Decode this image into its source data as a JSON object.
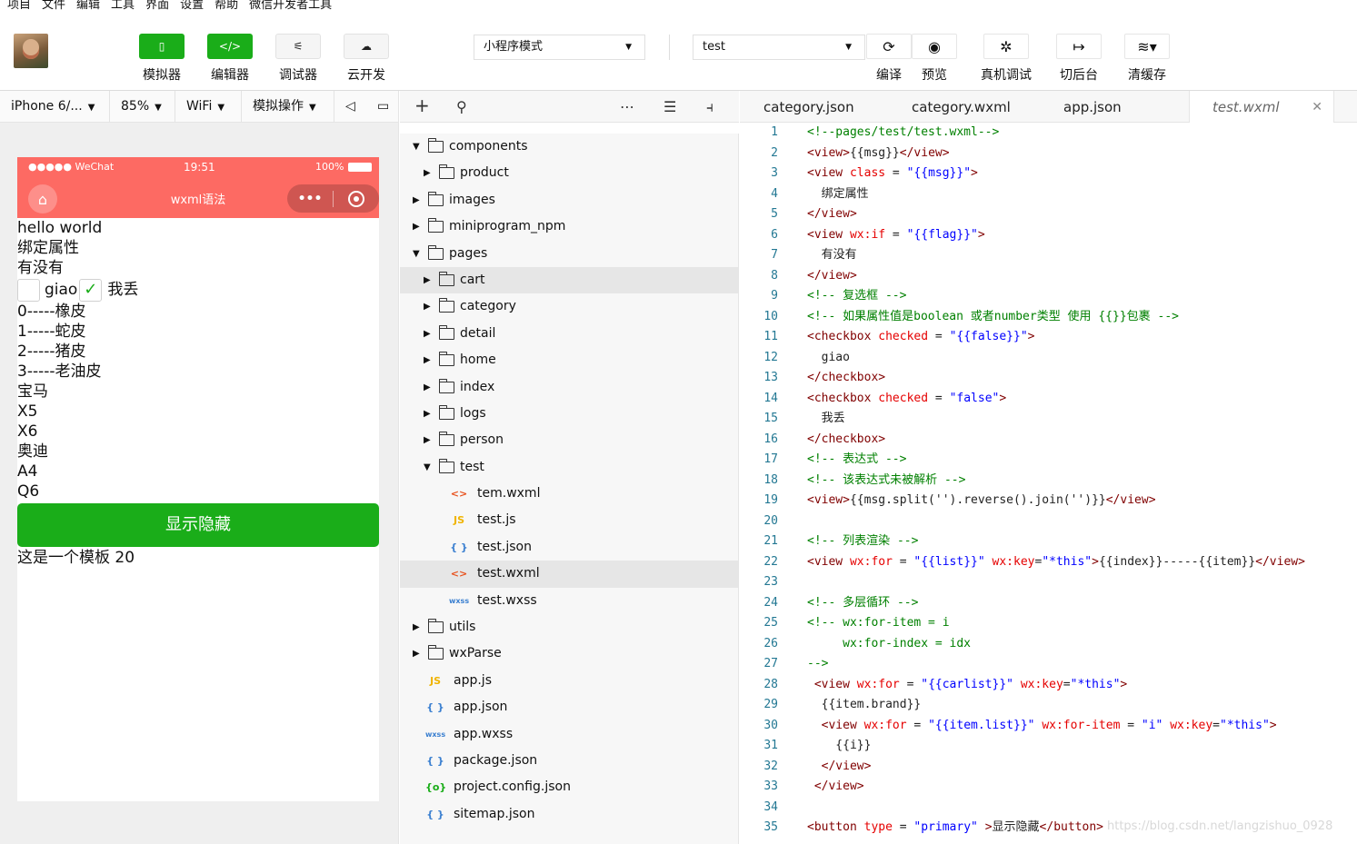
{
  "menu": [
    "项目",
    "文件",
    "编辑",
    "工具",
    "界面",
    "设置",
    "帮助",
    "微信开发者工具"
  ],
  "toolbar": {
    "left_buttons": [
      {
        "icon": "phone-icon",
        "label": "模拟器"
      },
      {
        "icon": "code-icon",
        "label": "编辑器"
      },
      {
        "icon": "debugger-icon",
        "label": "调试器"
      },
      {
        "icon": "cloud-icon",
        "label": "云开发"
      }
    ],
    "mode": "小程序模式",
    "compile_target": "test",
    "right_buttons": [
      {
        "icon": "refresh-icon",
        "label": "编译"
      },
      {
        "icon": "eye-icon",
        "label": "预览"
      },
      {
        "icon": "bug-icon",
        "label": "真机调试"
      },
      {
        "icon": "background-icon",
        "label": "切后台"
      },
      {
        "icon": "layers-icon",
        "label": "清缓存"
      }
    ]
  },
  "simulator": {
    "device": "iPhone 6/...",
    "zoom": "85%",
    "network": "WiFi",
    "operate": "模拟操作",
    "status": {
      "carrier": "●●●●● WeChat",
      "time": "19:51",
      "battery": "100%"
    },
    "nav_title": "wxml语法",
    "content": {
      "lines_top": [
        "hello world",
        "绑定属性",
        "有没有"
      ],
      "checkbox1_label": "giao",
      "checkbox2_label": "我丢",
      "lines_bottom": [
        "0-----橡皮",
        "1-----蛇皮",
        "2-----猪皮",
        "3-----老油皮",
        "宝马",
        "X5",
        "X6",
        "奥迪",
        "A4",
        "Q6"
      ],
      "button": "显示隐藏",
      "footer": "这是一个模板 20"
    }
  },
  "file_tree": [
    {
      "label": "components",
      "type": "folder",
      "level": 0,
      "open": true
    },
    {
      "label": "product",
      "type": "folder",
      "level": 1,
      "open": false
    },
    {
      "label": "images",
      "type": "folder",
      "level": 0,
      "open": false
    },
    {
      "label": "miniprogram_npm",
      "type": "folder",
      "level": 0,
      "open": false
    },
    {
      "label": "pages",
      "type": "folder",
      "level": 0,
      "open": true
    },
    {
      "label": "cart",
      "type": "folder",
      "level": 1,
      "open": false,
      "selected": true
    },
    {
      "label": "category",
      "type": "folder",
      "level": 1,
      "open": false
    },
    {
      "label": "detail",
      "type": "folder",
      "level": 1,
      "open": false
    },
    {
      "label": "home",
      "type": "folder",
      "level": 1,
      "open": false
    },
    {
      "label": "index",
      "type": "folder",
      "level": 1,
      "open": false
    },
    {
      "label": "logs",
      "type": "folder",
      "level": 1,
      "open": false
    },
    {
      "label": "person",
      "type": "folder",
      "level": 1,
      "open": false
    },
    {
      "label": "test",
      "type": "folder",
      "level": 1,
      "open": true
    },
    {
      "label": "tem.wxml",
      "type": "wxml",
      "level": 2
    },
    {
      "label": "test.js",
      "type": "js",
      "level": 2
    },
    {
      "label": "test.json",
      "type": "json",
      "level": 2
    },
    {
      "label": "test.wxml",
      "type": "wxml",
      "level": 2,
      "selected": true
    },
    {
      "label": "test.wxss",
      "type": "wxss",
      "level": 2
    },
    {
      "label": "utils",
      "type": "folder",
      "level": 0,
      "open": false
    },
    {
      "label": "wxParse",
      "type": "folder",
      "level": 0,
      "open": false
    },
    {
      "label": "app.js",
      "type": "js",
      "level": 1
    },
    {
      "label": "app.json",
      "type": "json",
      "level": 1
    },
    {
      "label": "app.wxss",
      "type": "wxss",
      "level": 1
    },
    {
      "label": "package.json",
      "type": "json",
      "level": 1
    },
    {
      "label": "project.config.json",
      "type": "config",
      "level": 1
    },
    {
      "label": "sitemap.json",
      "type": "json",
      "level": 1
    }
  ],
  "tabs": [
    "category.json",
    "category.wxml",
    "app.json",
    "test.wxml"
  ],
  "active_tab": "test.wxml",
  "code_lines": [
    "<!--pages/test/test.wxml-->",
    "<view>{{msg}}</view>",
    "<view class = \"{{msg}}\">",
    "  绑定属性",
    "</view>",
    "<view wx:if = \"{{flag}}\">",
    "  有没有",
    "</view>",
    "<!-- 复选框 -->",
    "<!-- 如果属性值是boolean 或者number类型 使用 {{}}包裹 -->",
    "<checkbox checked = \"{{false}}\">",
    "  giao",
    "</checkbox>",
    "<checkbox checked = \"false\">",
    "  我丢",
    "</checkbox>",
    "<!-- 表达式 -->",
    "<!-- 该表达式未被解析 -->",
    "<view>{{msg.split('').reverse().join('')}}</view>",
    "",
    "<!-- 列表渲染 -->",
    "<view wx:for = \"{{list}}\" wx:key=\"*this\">{{index}}-----{{item}}</view>",
    "",
    "<!-- 多层循环 -->",
    "<!-- wx:for-item = i",
    "     wx:for-index = idx",
    "-->",
    " <view wx:for = \"{{carlist}}\" wx:key=\"*this\">",
    "  {{item.brand}}",
    "  <view wx:for = \"{{item.list}}\" wx:for-item = \"i\" wx:key=\"*this\">",
    "    {{i}}",
    "  </view>",
    " </view>",
    "",
    "<button type = \"primary\" >显示隐藏</button>"
  ],
  "watermark": "https://blog.csdn.net/langzishuo_0928"
}
